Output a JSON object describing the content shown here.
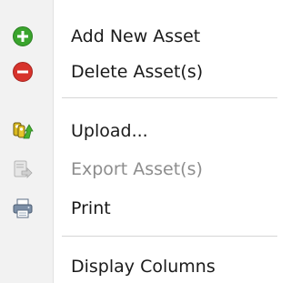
{
  "menu": {
    "items": [
      {
        "label": "Add New Asset",
        "icon": "add-green-circle-icon",
        "enabled": true
      },
      {
        "label": "Delete Asset(s)",
        "icon": "delete-red-circle-icon",
        "enabled": true
      },
      {
        "label": "Upload...",
        "icon": "upload-keys-arrow-icon",
        "enabled": true
      },
      {
        "label": "Export Asset(s)",
        "icon": "export-icon",
        "enabled": false
      },
      {
        "label": "Print",
        "icon": "printer-icon",
        "enabled": true
      },
      {
        "label": "Display Columns",
        "icon": "",
        "enabled": true
      }
    ]
  },
  "colors": {
    "add": "#3aa42d",
    "delete": "#d7332c",
    "disabled_text": "#8d8d8d",
    "gutter": "#f2f2f2"
  }
}
